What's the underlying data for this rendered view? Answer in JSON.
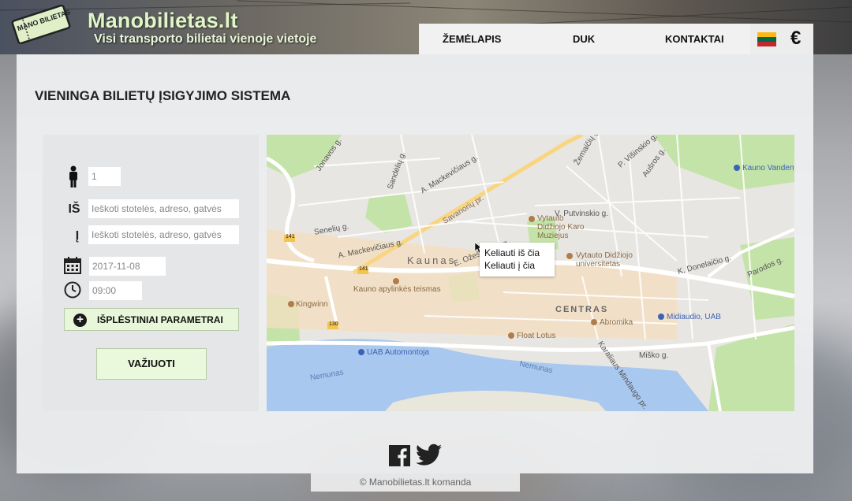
{
  "header": {
    "logo_text": "MANO BILIETAS",
    "site_title": "Manobilietas.lt",
    "tagline": "Visi transporto bilietai vienoje vietoje",
    "nav": [
      {
        "label": "ŽEMĖLAPIS"
      },
      {
        "label": "DUK"
      },
      {
        "label": "KONTAKTAI"
      }
    ],
    "currency_symbol": "€",
    "flag_colors": [
      "#fdb913",
      "#006a44",
      "#c1272d"
    ]
  },
  "main": {
    "page_title": "VIENINGA BILIETŲ ĮSIGYJIMO SISTEMA",
    "form": {
      "passengers_value": "1",
      "from_label": "IŠ",
      "from_placeholder": "Ieškoti stotelės, adreso, gatvės",
      "to_label": "Į",
      "to_placeholder": "Ieškoti stotelės, adreso, gatvės",
      "date_value": "2017-11-08",
      "time_value": "09:00",
      "extended_params_label": "IŠPLĖSTINIAI PARAMETRAI",
      "submit_label": "VAŽIUOTI"
    },
    "map": {
      "context_menu": [
        "Keliauti iš čia",
        "Keliauti į čia"
      ],
      "city": "Kaunas",
      "district": "CENTRAS",
      "streets": [
        "Jonavos g.",
        "Savanorių pr.",
        "A. Mackevičiaus g.",
        "Senelių g.",
        "Sandėlių g.",
        "Žemaičių g.",
        "P. Višinskio g.",
        "Aušros g.",
        "Kauno Vandenys",
        "V. Putvinskio g.",
        "A. Mackevičiaus g.",
        "E. Ožeškienės g.",
        "Nemunas",
        "Neris",
        "Karaliaus Mindaugo pr.",
        "Miško g.",
        "K. Donelaičio g.",
        "Parodos g."
      ],
      "pois": [
        "Vytauto Didžiojo Karo Muziejus",
        "Vytauto Didžiojo universitetas",
        "Kauno apylinkės teismas",
        "Kingwinn",
        "Abromika",
        "Float Lotus"
      ],
      "pois_blue": [
        "UAB Automontoja",
        "Midiaudio, UAB",
        "Kauno Vandenys"
      ],
      "road_numbers": [
        "141",
        "141",
        "130"
      ]
    }
  },
  "footer": {
    "social_icons": [
      "facebook-icon",
      "twitter-icon"
    ],
    "copyright_symbol": "©",
    "copyright_text": "Manobilietas.lt komanda"
  }
}
